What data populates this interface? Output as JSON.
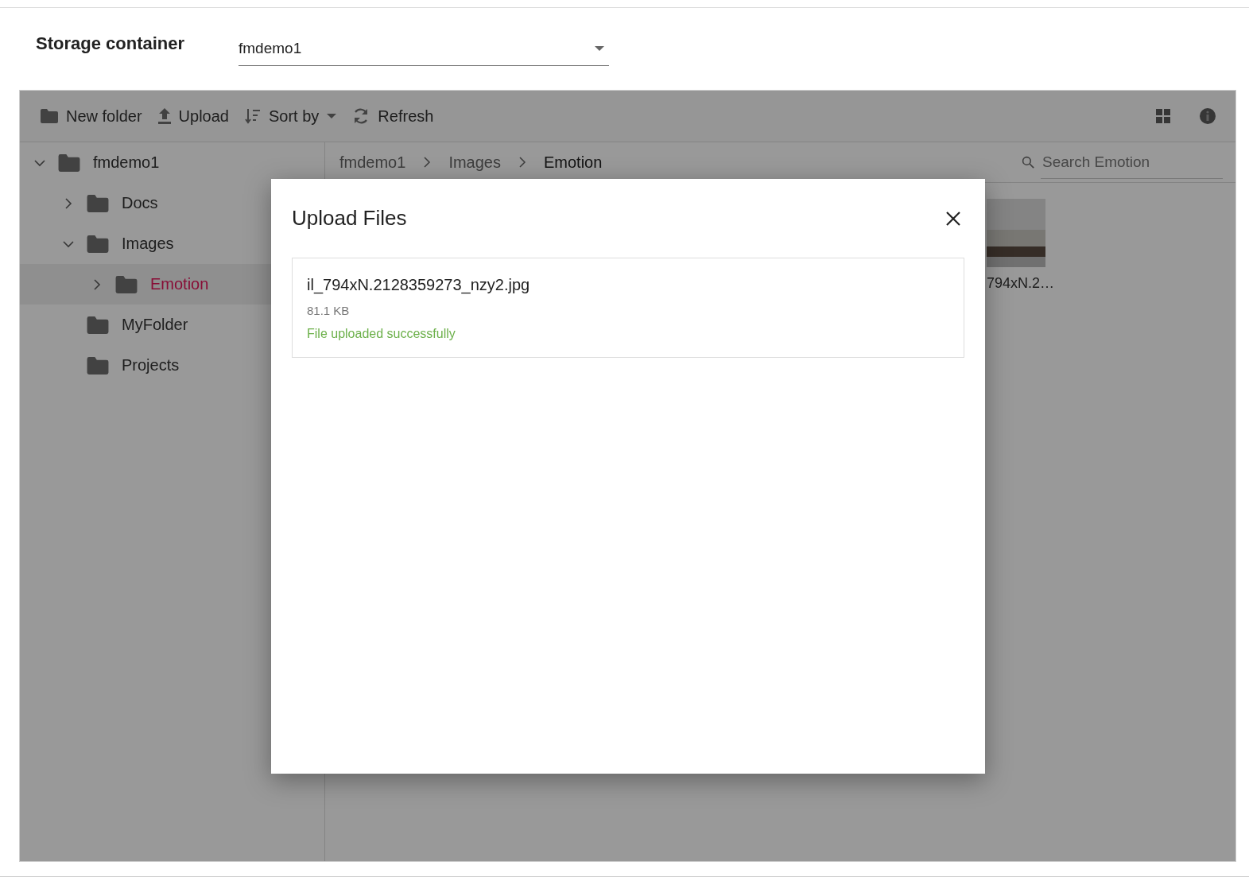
{
  "header": {
    "label": "Storage container",
    "select": {
      "value": "fmdemo1"
    }
  },
  "toolbar": {
    "items": [
      {
        "kind": "new-folder",
        "label": "New folder"
      },
      {
        "kind": "upload",
        "label": "Upload"
      },
      {
        "kind": "sort",
        "label": "Sort by"
      },
      {
        "kind": "refresh",
        "label": "Refresh"
      }
    ],
    "right_icons": [
      {
        "kind": "grid"
      },
      {
        "kind": "info"
      }
    ]
  },
  "tree": [
    {
      "label": "fmdemo1",
      "expandable": true,
      "expanded": true,
      "selected": false,
      "children": [
        {
          "label": "Docs",
          "expandable": true,
          "expanded": false,
          "selected": false
        },
        {
          "label": "Images",
          "expandable": true,
          "expanded": true,
          "selected": false,
          "children": [
            {
              "label": "Emotion",
              "expandable": true,
              "expanded": false,
              "selected": true
            }
          ]
        },
        {
          "label": "MyFolder",
          "expandable": false,
          "expanded": false,
          "selected": false
        },
        {
          "label": "Projects",
          "expandable": false,
          "expanded": false,
          "selected": false
        }
      ]
    }
  ],
  "breadcrumb": [
    {
      "label": "fmdemo1",
      "current": false
    },
    {
      "label": "Images",
      "current": false
    },
    {
      "label": "Emotion",
      "current": true
    }
  ],
  "search": {
    "placeholder": "Search Emotion"
  },
  "files": [
    {
      "name": "794xN.2…"
    }
  ],
  "dialog": {
    "title": "Upload Files",
    "uploads": [
      {
        "name": "il_794xN.2128359273_nzy2.jpg",
        "size": "81.1 KB",
        "status": "File uploaded successfully",
        "success": true
      }
    ]
  }
}
